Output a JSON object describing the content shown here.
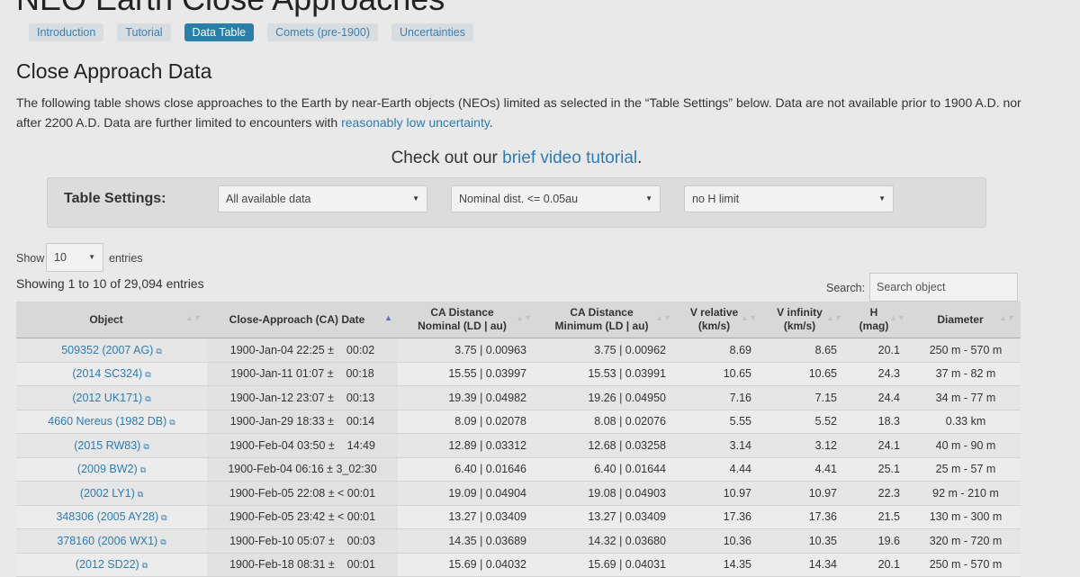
{
  "page": {
    "title": "NEO Earth Close Approaches",
    "tabs": [
      {
        "label": "Introduction",
        "active": false
      },
      {
        "label": "Tutorial",
        "active": false
      },
      {
        "label": "Data Table",
        "active": true
      },
      {
        "label": "Comets (pre-1900)",
        "active": false
      },
      {
        "label": "Uncertainties",
        "active": false
      }
    ],
    "section_title": "Close Approach Data",
    "intro_text": "The following table shows close approaches to the Earth by near-Earth objects (NEOs) limited as selected in the “Table Settings” below. Data are not available prior to 1900 A.D. nor after 2200 A.D. Data are further limited to encounters with ",
    "intro_link": "reasonably low uncertainty",
    "intro_end": ".",
    "video_prefix": "Check out our ",
    "video_link": "brief video tutorial",
    "video_suffix": "."
  },
  "settings": {
    "label": "Table Settings:",
    "data_select": "All available data",
    "dist_select": "Nominal dist. <= 0.05au",
    "h_select": "no H limit"
  },
  "controls": {
    "show_label": "Show",
    "entries_value": "10",
    "entries_label": "entries",
    "showing_text": "Showing 1 to 10 of 29,094 entries",
    "search_label": "Search:",
    "search_placeholder": "Search object"
  },
  "table": {
    "headers": [
      {
        "line1": "Object",
        "line2": "",
        "sort": "▲▼",
        "active": false
      },
      {
        "line1": "Close-Approach (CA) Date",
        "line2": "",
        "sort": "▲",
        "active": true
      },
      {
        "line1": "CA Distance",
        "line2": "Nominal (LD | au)",
        "sort": "▲▼",
        "active": false
      },
      {
        "line1": "CA Distance",
        "line2": "Minimum (LD | au)",
        "sort": "▲▼",
        "active": false
      },
      {
        "line1": "V relative",
        "line2": "(km/s)",
        "sort": "▲▼",
        "active": false
      },
      {
        "line1": "V infinity",
        "line2": "(km/s)",
        "sort": "▲▼",
        "active": false
      },
      {
        "line1": "H",
        "line2": "(mag)",
        "sort": "▲▼",
        "active": false
      },
      {
        "line1": "Diameter",
        "line2": "",
        "sort": "▲▼",
        "active": false
      }
    ],
    "rows": [
      {
        "object": "509352 (2007 AG)",
        "date": "1900-Jan-04 22:25 ±    00:02",
        "nominal": "3.75 | 0.00963",
        "minimum": "3.75 | 0.00962",
        "v_rel": "8.69",
        "v_inf": "8.65",
        "h": "20.1",
        "diameter": "250 m - 570 m"
      },
      {
        "object": "(2014 SC324)",
        "date": "1900-Jan-11 01:07 ±    00:18",
        "nominal": "15.55 | 0.03997",
        "minimum": "15.53 | 0.03991",
        "v_rel": "10.65",
        "v_inf": "10.65",
        "h": "24.3",
        "diameter": "37 m - 82 m"
      },
      {
        "object": "(2012 UK171)",
        "date": "1900-Jan-12 23:07 ±    00:13",
        "nominal": "19.39 | 0.04982",
        "minimum": "19.26 | 0.04950",
        "v_rel": "7.16",
        "v_inf": "7.15",
        "h": "24.4",
        "diameter": "34 m - 77 m"
      },
      {
        "object": "4660 Nereus (1982 DB)",
        "date": "1900-Jan-29 18:33 ±    00:14",
        "nominal": "8.09 | 0.02078",
        "minimum": "8.08 | 0.02076",
        "v_rel": "5.55",
        "v_inf": "5.52",
        "h": "18.3",
        "diameter": "0.33 km"
      },
      {
        "object": "(2015 RW83)",
        "date": "1900-Feb-04 03:50 ±    14:49",
        "nominal": "12.89 | 0.03312",
        "minimum": "12.68 | 0.03258",
        "v_rel": "3.14",
        "v_inf": "3.12",
        "h": "24.1",
        "diameter": "40 m - 90 m"
      },
      {
        "object": "(2009 BW2)",
        "date": "1900-Feb-04 06:16 ± 3_02:30",
        "nominal": "6.40 | 0.01646",
        "minimum": "6.40 | 0.01644",
        "v_rel": "4.44",
        "v_inf": "4.41",
        "h": "25.1",
        "diameter": "25 m - 57 m"
      },
      {
        "object": "(2002 LY1)",
        "date": "1900-Feb-05 22:08 ± < 00:01",
        "nominal": "19.09 | 0.04904",
        "minimum": "19.08 | 0.04903",
        "v_rel": "10.97",
        "v_inf": "10.97",
        "h": "22.3",
        "diameter": "92 m - 210 m"
      },
      {
        "object": "348306 (2005 AY28)",
        "date": "1900-Feb-05 23:42 ± < 00:01",
        "nominal": "13.27 | 0.03409",
        "minimum": "13.27 | 0.03409",
        "v_rel": "17.36",
        "v_inf": "17.36",
        "h": "21.5",
        "diameter": "130 m - 300 m"
      },
      {
        "object": "378160 (2006 WX1)",
        "date": "1900-Feb-10 05:07 ±    00:03",
        "nominal": "14.35 | 0.03689",
        "minimum": "14.32 | 0.03680",
        "v_rel": "10.36",
        "v_inf": "10.35",
        "h": "19.6",
        "diameter": "320 m - 720 m"
      },
      {
        "object": "(2012 SD22)",
        "date": "1900-Feb-18 08:31 ±    00:01",
        "nominal": "15.69 | 0.04032",
        "minimum": "15.69 | 0.04031",
        "v_rel": "14.35",
        "v_inf": "14.34",
        "h": "20.1",
        "diameter": "250 m - 570 m"
      }
    ]
  },
  "icons": {
    "external_link": "⧉",
    "caret": "▼"
  },
  "colors": {
    "link": "#2d7cb5",
    "active_tab": "#2a7fa8",
    "sort_active": "#5a6fb5"
  }
}
